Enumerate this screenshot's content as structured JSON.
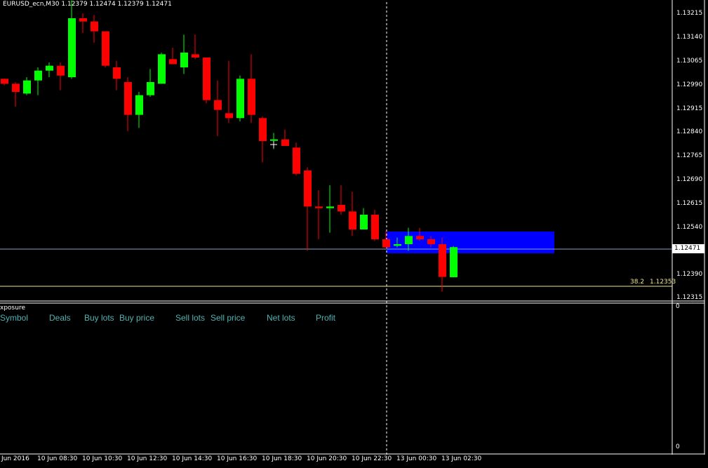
{
  "header": {
    "text": "EURUSD_ecn,M30  1.12379 1.12474 1.12379 1.12471"
  },
  "price_axis": {
    "labels": [
      "1.13215",
      "1.13140",
      "1.13065",
      "1.12990",
      "1.12915",
      "1.12840",
      "1.12765",
      "1.12690",
      "1.12615",
      "1.12540",
      "1.12390",
      "1.12315"
    ],
    "current": "1.12471"
  },
  "fibo": {
    "level": "38.2",
    "price": "1.12353"
  },
  "indicator": {
    "title": "xposure",
    "scale_top": "0",
    "scale_bottom": "0",
    "columns": [
      "Symbol",
      "Deals",
      "Buy lots",
      "Buy price",
      "Sell lots",
      "Sell price",
      "Net lots",
      "Profit"
    ]
  },
  "time_axis": {
    "labels": [
      "Jun 2016",
      "10 Jun 08:30",
      "10 Jun 10:30",
      "10 Jun 12:30",
      "10 Jun 14:30",
      "10 Jun 16:30",
      "10 Jun 18:30",
      "10 Jun 20:30",
      "10 Jun 22:30",
      "13 Jun 00:30",
      "13 Jun 02:30"
    ]
  },
  "colors": {
    "bull": "#00ff00",
    "bear": "#ff0000",
    "zone": "#0000ff",
    "fibo": "#f0e68c",
    "bid_line": "#8aa0c8",
    "text": "#ffffff",
    "columns": "#4fb3b3"
  },
  "candles": [
    {
      "o": 1.12985,
      "h": 1.12985,
      "l": 1.12965,
      "c": 1.1297
    },
    {
      "o": 1.1297,
      "h": 1.12975,
      "l": 1.129,
      "c": 1.12945
    },
    {
      "o": 1.1294,
      "h": 1.1299,
      "l": 1.12935,
      "c": 1.1298
    },
    {
      "o": 1.1298,
      "h": 1.1302,
      "l": 1.12935,
      "c": 1.1301
    },
    {
      "o": 1.1301,
      "h": 1.13035,
      "l": 1.1299,
      "c": 1.13025
    },
    {
      "o": 1.13025,
      "h": 1.13035,
      "l": 1.1295,
      "c": 1.12995
    },
    {
      "o": 1.1299,
      "h": 1.13225,
      "l": 1.12985,
      "c": 1.1317
    },
    {
      "o": 1.1317,
      "h": 1.13185,
      "l": 1.13125,
      "c": 1.1316
    },
    {
      "o": 1.1316,
      "h": 1.1318,
      "l": 1.13095,
      "c": 1.1313
    },
    {
      "o": 1.1313,
      "h": 1.1313,
      "l": 1.1302,
      "c": 1.13025
    },
    {
      "o": 1.1302,
      "h": 1.1304,
      "l": 1.1295,
      "c": 1.12985
    },
    {
      "o": 1.12975,
      "h": 1.1299,
      "l": 1.12825,
      "c": 1.12875
    },
    {
      "o": 1.12875,
      "h": 1.12945,
      "l": 1.12835,
      "c": 1.12935
    },
    {
      "o": 1.12935,
      "h": 1.13015,
      "l": 1.1293,
      "c": 1.12975
    },
    {
      "o": 1.1297,
      "h": 1.13065,
      "l": 1.1297,
      "c": 1.1306
    },
    {
      "o": 1.13045,
      "h": 1.1308,
      "l": 1.13035,
      "c": 1.1303
    },
    {
      "o": 1.1302,
      "h": 1.1312,
      "l": 1.13,
      "c": 1.13065
    },
    {
      "o": 1.1306,
      "h": 1.1312,
      "l": 1.13045,
      "c": 1.1305
    },
    {
      "o": 1.1305,
      "h": 1.1305,
      "l": 1.1291,
      "c": 1.1292
    },
    {
      "o": 1.1292,
      "h": 1.1298,
      "l": 1.1281,
      "c": 1.1289
    },
    {
      "o": 1.1288,
      "h": 1.1304,
      "l": 1.1285,
      "c": 1.12865
    },
    {
      "o": 1.12865,
      "h": 1.12995,
      "l": 1.12855,
      "c": 1.12985
    },
    {
      "o": 1.12985,
      "h": 1.1306,
      "l": 1.1285,
      "c": 1.12875
    },
    {
      "o": 1.12865,
      "h": 1.1287,
      "l": 1.1273,
      "c": 1.12795
    },
    {
      "o": 1.128,
      "h": 1.1282,
      "l": 1.1277,
      "c": 1.128
    },
    {
      "o": 1.128,
      "h": 1.1283,
      "l": 1.1278,
      "c": 1.1278
    },
    {
      "o": 1.12775,
      "h": 1.1279,
      "l": 1.1269,
      "c": 1.12695
    },
    {
      "o": 1.12705,
      "h": 1.12715,
      "l": 1.1246,
      "c": 1.12595
    },
    {
      "o": 1.12595,
      "h": 1.12645,
      "l": 1.12495,
      "c": 1.1259
    },
    {
      "o": 1.1259,
      "h": 1.1266,
      "l": 1.12515,
      "c": 1.12595
    },
    {
      "o": 1.126,
      "h": 1.1266,
      "l": 1.1257,
      "c": 1.1258
    },
    {
      "o": 1.1258,
      "h": 1.1264,
      "l": 1.12505,
      "c": 1.12525
    },
    {
      "o": 1.12525,
      "h": 1.1259,
      "l": 1.12525,
      "c": 1.1257
    },
    {
      "o": 1.1257,
      "h": 1.12585,
      "l": 1.1249,
      "c": 1.12495
    },
    {
      "o": 1.12495,
      "h": 1.1252,
      "l": 1.1247,
      "c": 1.1247
    },
    {
      "o": 1.12475,
      "h": 1.125,
      "l": 1.1247,
      "c": 1.1248
    },
    {
      "o": 1.1248,
      "h": 1.1253,
      "l": 1.1246,
      "c": 1.12505
    },
    {
      "o": 1.12505,
      "h": 1.1253,
      "l": 1.1249,
      "c": 1.12495
    },
    {
      "o": 1.12495,
      "h": 1.12505,
      "l": 1.1247,
      "c": 1.1248
    },
    {
      "o": 1.1248,
      "h": 1.125,
      "l": 1.12335,
      "c": 1.1238
    },
    {
      "o": 1.12379,
      "h": 1.12474,
      "l": 1.12379,
      "c": 1.12471
    }
  ]
}
